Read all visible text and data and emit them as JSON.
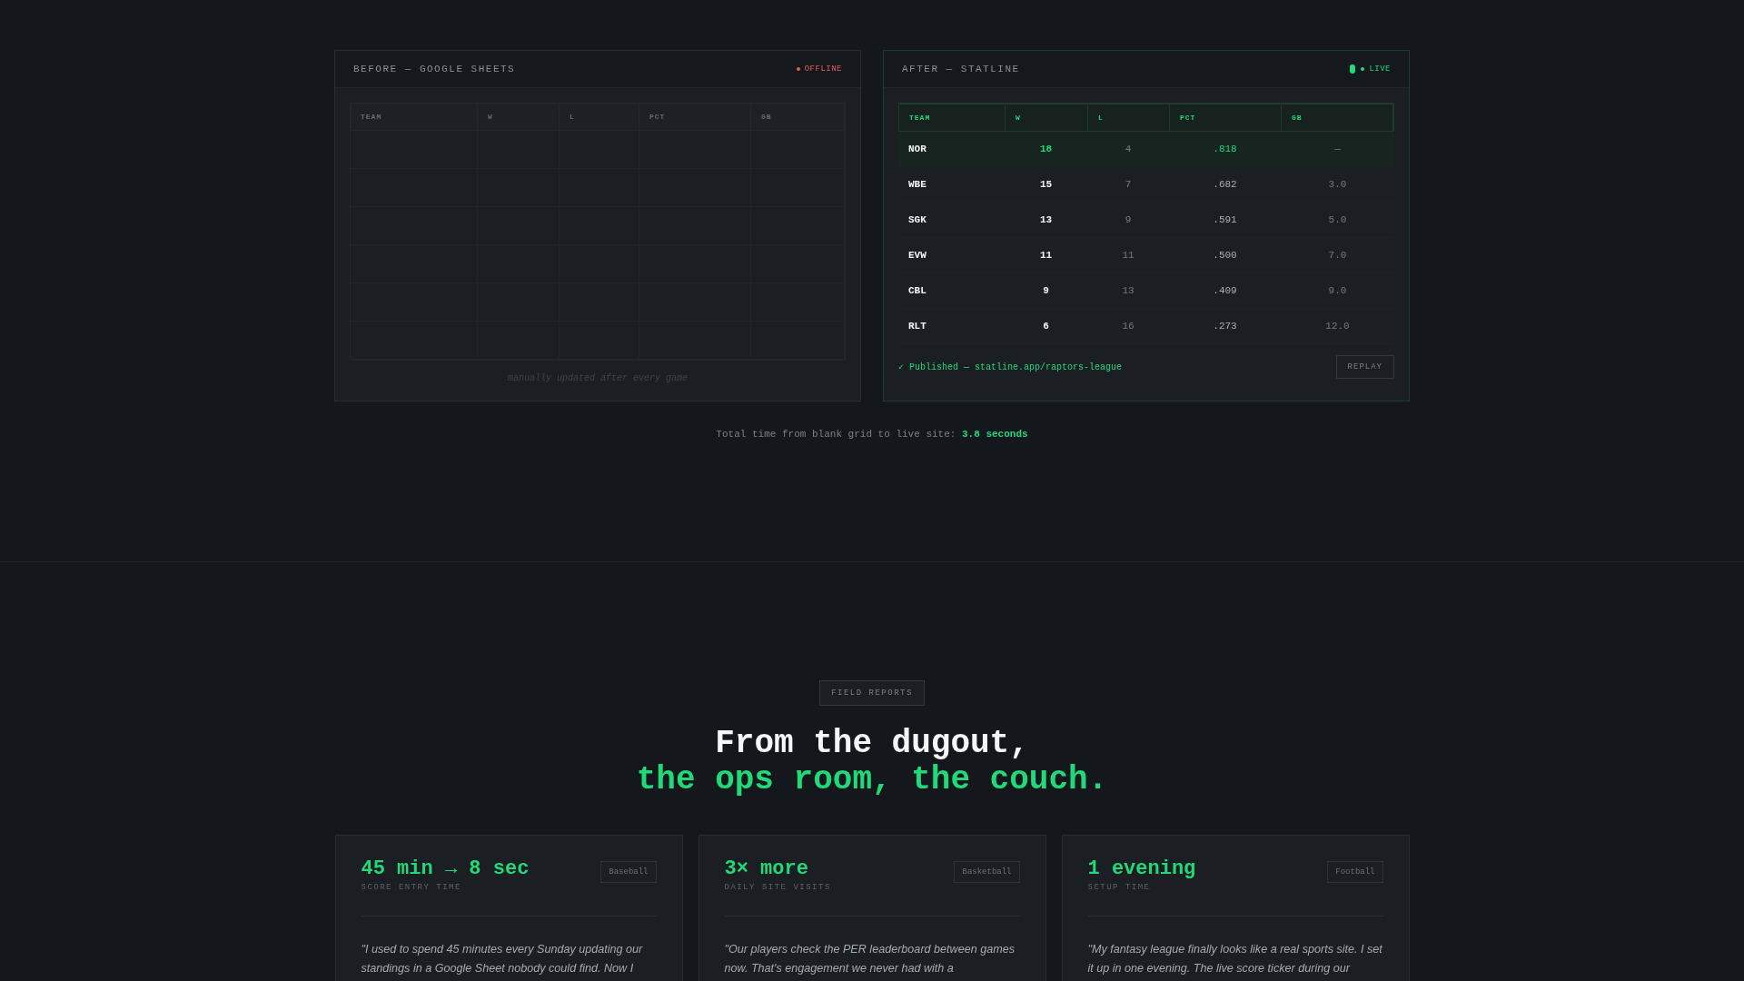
{
  "comparison": {
    "before": {
      "title": "BEFORE — GOOGLE SHEETS",
      "status": "OFFLINE",
      "live": false,
      "columns": [
        "TEAM",
        "W",
        "L",
        "PCT",
        "GB"
      ],
      "note": "manually updated after every game"
    },
    "after": {
      "title": "AFTER — STATLINE",
      "status": "LIVE",
      "live": true,
      "columns": [
        "TEAM",
        "W",
        "L",
        "PCT",
        "GB"
      ],
      "rows": [
        {
          "team": "NOR",
          "w": "18",
          "l": "4",
          "pct": ".818",
          "gb": "—",
          "highlighted": true
        },
        {
          "team": "WBE",
          "w": "15",
          "l": "7",
          "pct": ".682",
          "gb": "3.0",
          "highlighted": false
        },
        {
          "team": "SGK",
          "w": "13",
          "l": "9",
          "pct": ".591",
          "gb": "5.0",
          "highlighted": false
        },
        {
          "team": "EVW",
          "w": "11",
          "l": "11",
          "pct": ".500",
          "gb": "7.0",
          "highlighted": false
        },
        {
          "team": "CBL",
          "w": "9",
          "l": "13",
          "pct": ".409",
          "gb": "9.0",
          "highlighted": false
        },
        {
          "team": "RLT",
          "w": "6",
          "l": "16",
          "pct": ".273",
          "gb": "12.0",
          "highlighted": false
        }
      ],
      "published": "✓ Published — statline.app/raptors-league",
      "button": "REPLAY"
    },
    "total_time": "Total time from blank grid to live site: **3.8 seconds**"
  },
  "field_reports": {
    "badge": "FIELD REPORTS",
    "heading_line1": "From the dugout,",
    "heading_line2": "the ops room, the couch.",
    "cards": [
      {
        "metric": "45 min → 8 sec",
        "label": "SCORE ENTRY TIME",
        "sport": "Baseball",
        "quote": "\"I used to spend 45 minutes every Sunday updating our standings in a Google Sheet nobody could find. Now I"
      },
      {
        "metric": "3× more",
        "label": "DAILY SITE VISITS",
        "sport": "Basketball",
        "quote": "\"Our players check the PER leaderboard between games now. That's engagement we never had with a"
      },
      {
        "metric": "1 evening",
        "label": "SETUP TIME",
        "sport": "Football",
        "quote": "\"My fantasy league finally looks like a real sports site. I set it up in one evening. The live score ticker during our"
      }
    ]
  }
}
